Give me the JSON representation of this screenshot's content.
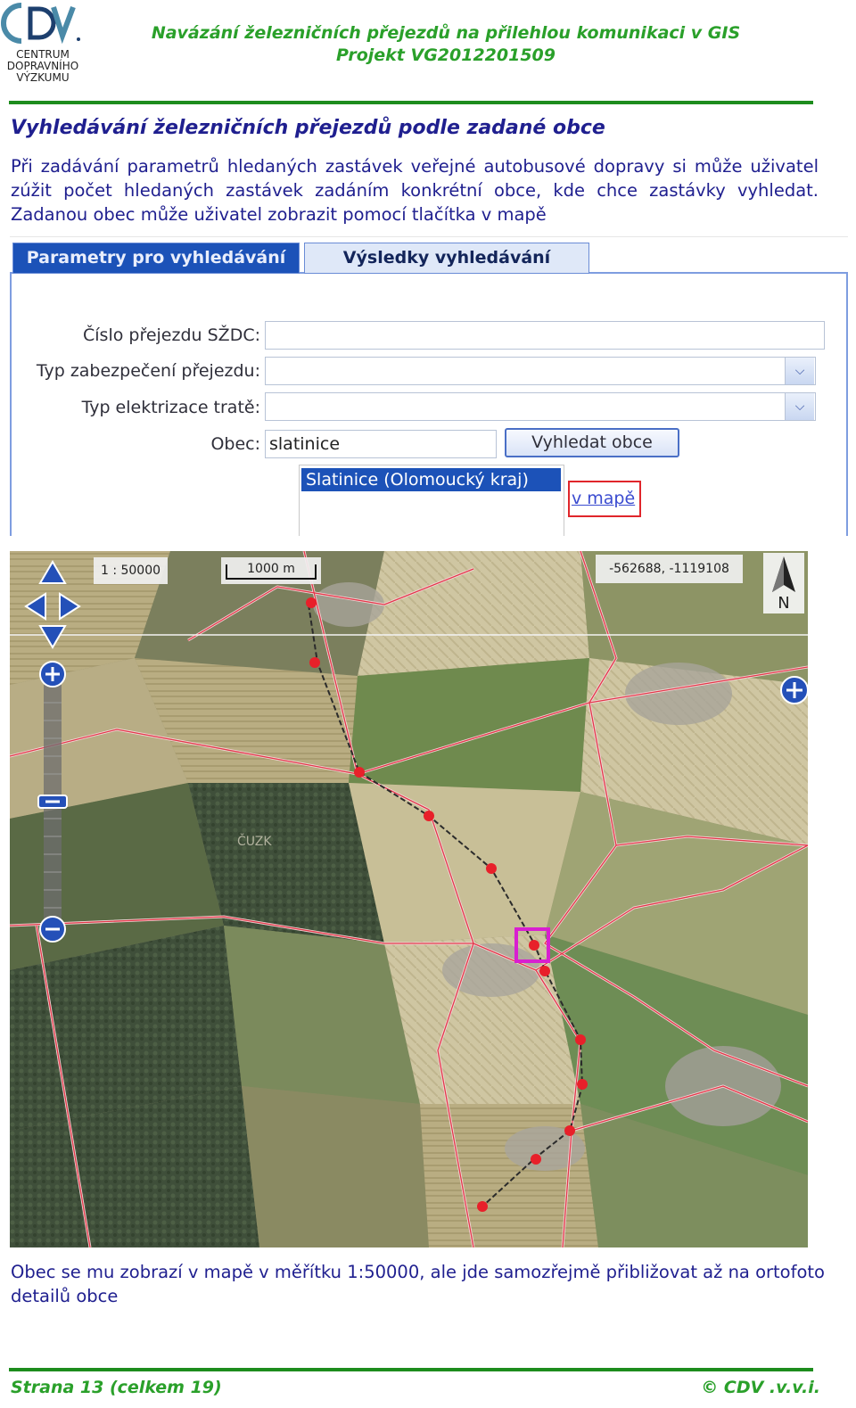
{
  "header": {
    "logo_lines": [
      "CENTRUM",
      "DOPRAVNÍHO",
      "VÝZKUMU"
    ],
    "title_line1": "Navázání železničních přejezdů na přilehlou komunikaci v GIS",
    "title_line2": "Projekt VG2012201509"
  },
  "section_title": "Vyhledávání železničních přejezdů podle zadané obce",
  "intro": {
    "line1": "Při zadávání parametrů hledaných zastávek veřejné autobusové dopravy si může uživatel",
    "line2": "zúžit počet hledaných zastávek zadáním konkrétní obce, kde chce zastávky vyhledat.",
    "line3": "Zadanou obec může uživatel zobrazit pomocí tlačítka v mapě"
  },
  "search_form": {
    "tabs": [
      "Parametry pro vyhledávání",
      "Výsledky vyhledávání"
    ],
    "fields": {
      "crossing_number_label": "Číslo přejezdu SŽDC:",
      "protection_type_label": "Typ zabezpečení přejezdu:",
      "electrification_label": "Typ elektrizace tratě:",
      "municipality_label": "Obec:",
      "municipality_value": "slatinice"
    },
    "find_button": "Vyhledat obce",
    "result_item": "Slatinice (Olomoucký kraj)",
    "map_link": "v mapě"
  },
  "map": {
    "scale_ratio": "1 : 50000",
    "scale_bar_label": "1000 m",
    "coordinates": "-562688, -1119108",
    "north_label": "N",
    "watermark": "ČUZK",
    "icons": [
      "pan-up-icon",
      "pan-left-icon",
      "pan-right-icon",
      "pan-down-icon",
      "zoom-in-icon",
      "zoom-out-icon",
      "north-arrow-icon",
      "overview-expand-icon"
    ]
  },
  "caption": {
    "line1": "Obec se mu zobrazí v mapě v měřítku 1:50000, ale jde samozřejmě přibližovat až na ortofoto",
    "line2": "detailů obce"
  },
  "footer": {
    "page": "Strana 13 (celkem 19)",
    "copyright": "© CDV .v.v.i."
  },
  "colors": {
    "brand_green": "#2aa02a",
    "text_blue": "#1f1f8f",
    "tab_active": "#1c52b8",
    "highlight_red": "#e0262b",
    "map_marker": "#e8202a",
    "location_box": "#d81fd0"
  }
}
